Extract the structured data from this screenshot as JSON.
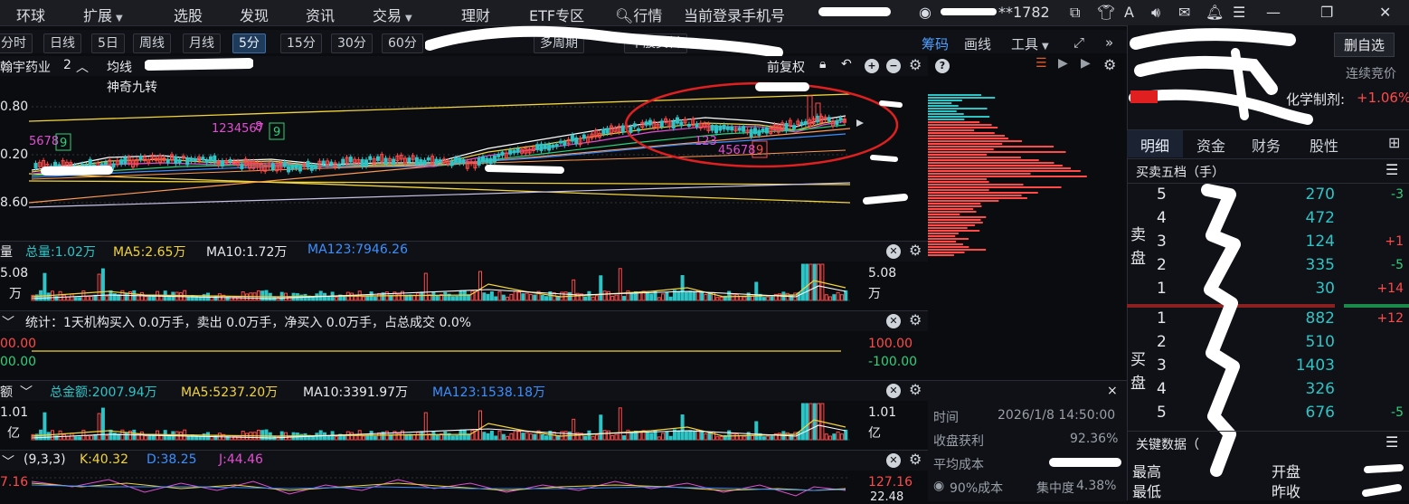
{
  "topbar": {
    "menu": [
      "环球",
      "扩展",
      "选股",
      "发现",
      "资讯",
      "交易",
      "理财",
      "ETF专区",
      "行情"
    ],
    "login_text": "当前登录手机号",
    "user_suffix": "**1782"
  },
  "toolbar": {
    "periods": [
      "分时",
      "日线",
      "5日",
      "周线",
      "月线",
      "5分",
      "15分",
      "30分",
      "60分"
    ],
    "active_period": "5分",
    "multi_period": "多周期",
    "stock_info": "个股资料",
    "chips": "筹码",
    "draw": "画线",
    "tools": "工具"
  },
  "main_chart": {
    "stock_name": "翰宇药业",
    "count": "2",
    "ma_label": "均线",
    "indicator": "神奇九转",
    "adjust": "前复权",
    "y_ticks": [
      "0.80",
      "0.20",
      "8.60"
    ],
    "nine_labels": [
      "5678",
      "9",
      "1234567",
      "8",
      "9",
      "123",
      "45678",
      "9"
    ]
  },
  "volume_panel": {
    "title": "量",
    "total": "总量:1.02万",
    "ma5": "MA5:2.65万",
    "ma10": "MA10:1.72万",
    "ma123": "MA123:7946.26",
    "y_left": [
      "5.08",
      "万"
    ],
    "y_right": [
      "5.08",
      "万"
    ]
  },
  "stats_panel": {
    "text": "统计：1天机构买入 0.0万手，卖出 0.0万手，净买入 0.0万手，占总成交 0.0%",
    "y_left_top": "00.00",
    "y_left_bottom": "00.00",
    "y_right_top": "100.00",
    "y_right_bottom": "-100.00"
  },
  "amount_panel": {
    "title": "额",
    "total": "总金额:2007.94万",
    "ma5": "MA5:5237.20万",
    "ma10": "MA10:3391.97万",
    "ma123": "MA123:1538.18万",
    "y_left": [
      "1.01",
      "亿"
    ],
    "y_right": [
      "1.01",
      "亿"
    ]
  },
  "kdj_panel": {
    "params": "(9,3,3)",
    "k": "K:40.32",
    "d": "D:38.25",
    "j": "J:44.46",
    "y_left": "7.16",
    "y_right": "127.16",
    "y_right2": "22.48"
  },
  "chip_info": {
    "time_label": "时间",
    "time_value": "2026/1/8 14:50:00",
    "profit_label": "收盘获利",
    "profit_value": "92.36%",
    "avg_cost_label": "平均成本",
    "cost90_label": "90%成本",
    "concentration_label": "集中度",
    "concentration_value": "4.38%"
  },
  "right_panel": {
    "watch_btn": "删自选",
    "auction": "连续竞价",
    "sector": "化学制剂:",
    "sector_change": "+1.06%",
    "tabs": [
      "明细",
      "资金",
      "财务",
      "股性"
    ],
    "book_title": "买卖五档（手）",
    "sell_label": [
      "卖",
      "盘"
    ],
    "buy_label": [
      "买",
      "盘"
    ],
    "asks": [
      {
        "level": "5",
        "vol": "270",
        "chg": "-3"
      },
      {
        "level": "4",
        "vol": "472",
        "chg": ""
      },
      {
        "level": "3",
        "vol": "124",
        "chg": "+1"
      },
      {
        "level": "2",
        "vol": "335",
        "chg": "-5"
      },
      {
        "level": "1",
        "vol": "30",
        "chg": "+14"
      }
    ],
    "bids": [
      {
        "level": "1",
        "vol": "882",
        "chg": "+12"
      },
      {
        "level": "2",
        "vol": "510",
        "chg": ""
      },
      {
        "level": "3",
        "vol": "1403",
        "chg": ""
      },
      {
        "level": "4",
        "vol": "326",
        "chg": ""
      },
      {
        "level": "5",
        "vol": "676",
        "chg": "-5"
      }
    ],
    "key_data_title": "关键数据（",
    "high": "最高",
    "low": "最低",
    "open": "开盘",
    "prev_close": "昨收"
  },
  "colors": {
    "up": "#ff4a4a",
    "down": "#2ec4c6",
    "accent": "#4da0ff"
  }
}
